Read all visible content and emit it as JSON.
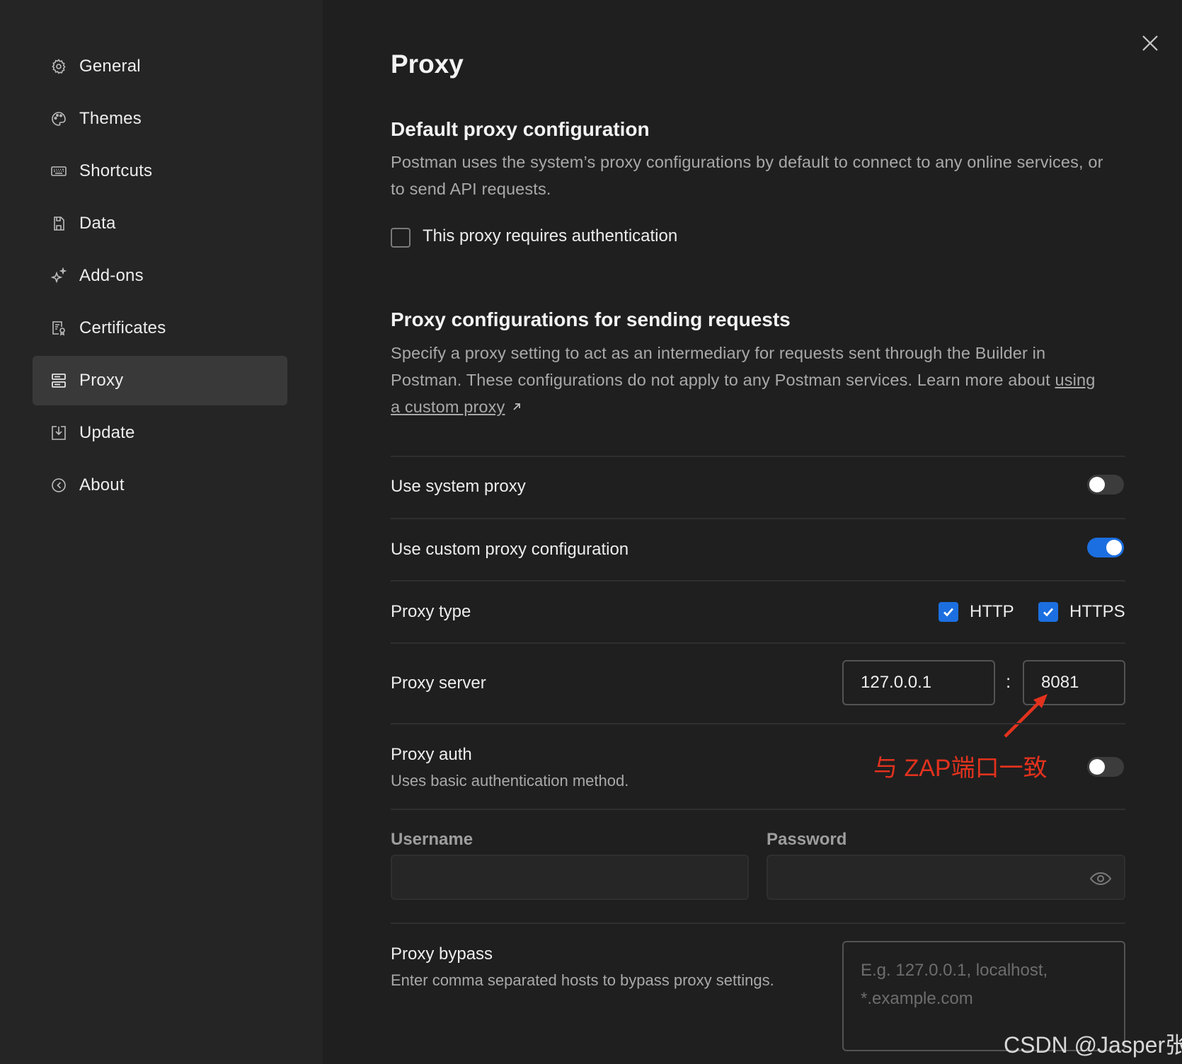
{
  "sidebar": {
    "items": [
      {
        "label": "General",
        "icon": "gear-icon",
        "active": false
      },
      {
        "label": "Themes",
        "icon": "palette-icon",
        "active": false
      },
      {
        "label": "Shortcuts",
        "icon": "keyboard-icon",
        "active": false
      },
      {
        "label": "Data",
        "icon": "save-icon",
        "active": false
      },
      {
        "label": "Add-ons",
        "icon": "sparkle-icon",
        "active": false
      },
      {
        "label": "Certificates",
        "icon": "certificate-icon",
        "active": false
      },
      {
        "label": "Proxy",
        "icon": "server-icon",
        "active": true
      },
      {
        "label": "Update",
        "icon": "download-icon",
        "active": false
      },
      {
        "label": "About",
        "icon": "postman-icon",
        "active": false
      }
    ]
  },
  "main": {
    "title": "Proxy",
    "default_section": {
      "heading": "Default proxy configuration",
      "description": "Postman uses the system’s proxy configurations by default to connect to any online services, or to send API requests.",
      "auth_checkbox_label": "This proxy requires authentication",
      "auth_checked": false
    },
    "requests_section": {
      "heading": "Proxy configurations for sending requests",
      "description": "Specify a proxy setting to act as an intermediary for requests sent through the Builder in Postman. These configurations do not apply to any Postman services. Learn more about ",
      "link_text": "using a custom proxy"
    },
    "system_proxy": {
      "label": "Use system proxy",
      "enabled": false
    },
    "custom_proxy": {
      "label": "Use custom proxy configuration",
      "enabled": true
    },
    "proxy_type": {
      "label": "Proxy type",
      "http": {
        "label": "HTTP",
        "checked": true
      },
      "https": {
        "label": "HTTPS",
        "checked": true
      }
    },
    "proxy_server": {
      "label": "Proxy server",
      "host": "127.0.0.1",
      "separator": ":",
      "port": "8081"
    },
    "proxy_auth": {
      "label": "Proxy auth",
      "sublabel": "Uses basic authentication method.",
      "enabled": false,
      "username_label": "Username",
      "username_value": "",
      "password_label": "Password",
      "password_value": ""
    },
    "proxy_bypass": {
      "label": "Proxy bypass",
      "sublabel": "Enter comma separated hosts to bypass proxy settings.",
      "placeholder_line1": "E.g. 127.0.0.1, localhost,",
      "placeholder_line2": "*.example.com"
    }
  },
  "annotation": {
    "text": "与 ZAP端口一致",
    "color": "#e2321e"
  },
  "watermark": "CSDN @Jasper张",
  "colors": {
    "accent": "#1c6fe0",
    "background": "#1f1f1f",
    "sidebar": "#252525",
    "active_item": "#393939"
  }
}
